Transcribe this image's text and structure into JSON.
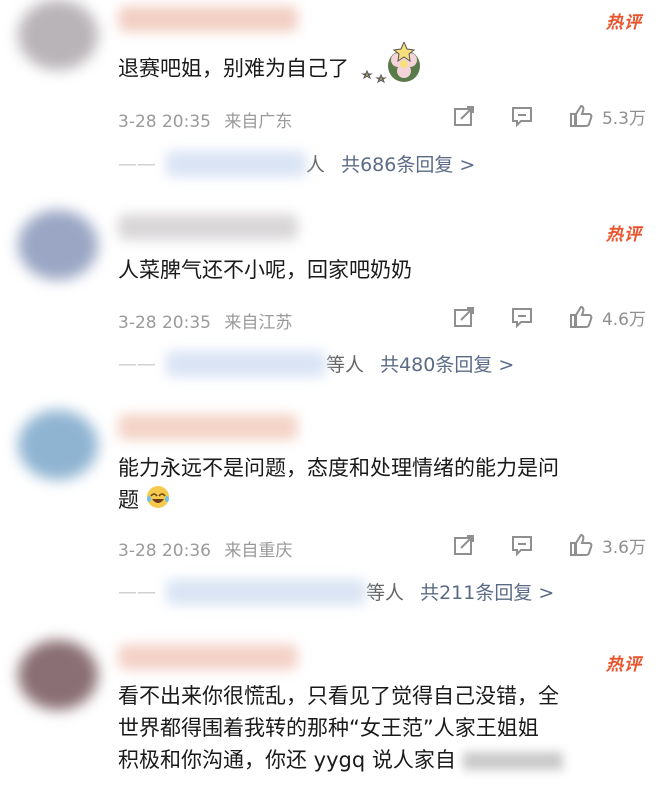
{
  "hot_label": "热评",
  "comments": [
    {
      "text": "退赛吧姐，别难为自己了",
      "date": "3-28 20:35",
      "location": "来自广东",
      "likes": "5.3万",
      "replies_who": "人",
      "replies_summary": "共686条回复 >",
      "emoji": "flower-star-icon"
    },
    {
      "text": "人菜脾气还不小呢，回家吧奶奶",
      "date": "3-28 20:35",
      "location": "来自江苏",
      "likes": "4.6万",
      "replies_who": "等人",
      "replies_summary": "共480条回复 >"
    },
    {
      "text_line1": "能力永远不是问题，态度和处理情绪的能力是问",
      "text_line2": "题",
      "date": "3-28 20:36",
      "location": "来自重庆",
      "likes": "3.6万",
      "replies_who": "等人",
      "replies_summary": "共211条回复 >",
      "emoji": "laugh-cry-icon"
    },
    {
      "text_line1": "看不出来你很慌乱，只看见了觉得自己没错，全",
      "text_line2": "世界都得围着我转的那种“女王范”人家王姐姐",
      "text_line3": "积极和你沟通，你还 yygq 说人家自"
    }
  ]
}
